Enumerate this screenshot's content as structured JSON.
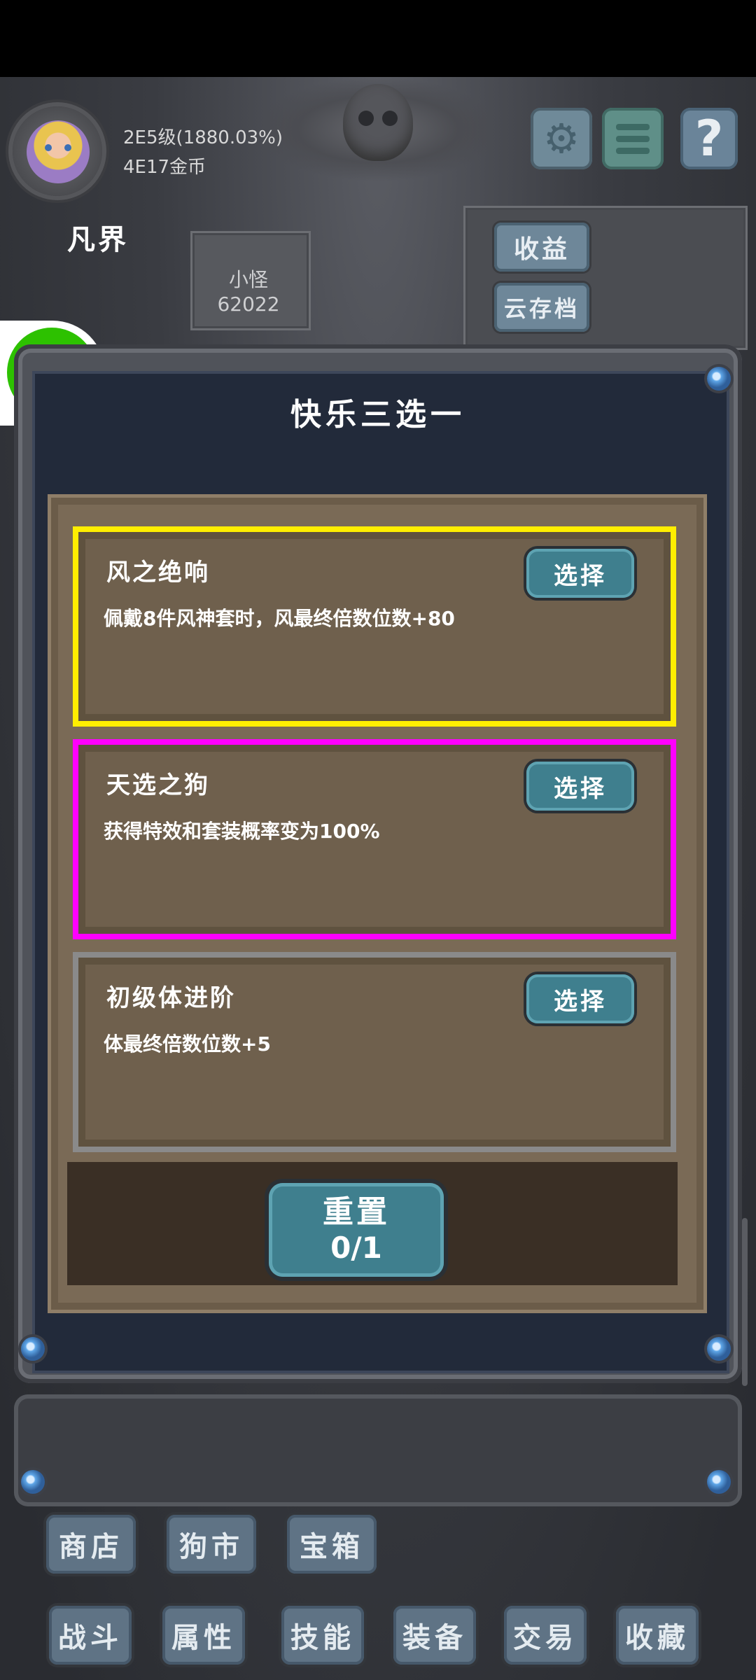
{
  "player": {
    "level": "2E5级(1880.03%)",
    "gold": "4E17金币",
    "realm": "凡界"
  },
  "enemy": {
    "name": "小怪",
    "count": "62022"
  },
  "top_buttons": {
    "income": "收益",
    "cloud_save": "云存档",
    "help": "?"
  },
  "dialog": {
    "title": "快乐三选一",
    "options": [
      {
        "title": "风之绝响",
        "desc": "佩戴8件风神套时，风最终倍数位数+80",
        "button": "选择",
        "highlight": "#ffee00"
      },
      {
        "title": "天选之狗",
        "desc": "获得特效和套装概率变为100%",
        "button": "选择",
        "highlight": "#ff00ff"
      },
      {
        "title": "初级体进阶",
        "desc": "体最终倍数位数+5",
        "button": "选择",
        "highlight": "#8a8a8a"
      }
    ],
    "reset": {
      "label": "重置",
      "count": "0/1"
    }
  },
  "nav_row1": [
    "商店",
    "狗市",
    "宝箱"
  ],
  "nav_row2": [
    "战斗",
    "属性",
    "技能",
    "装备",
    "交易",
    "收藏"
  ],
  "colors": {
    "accent_button": "#3f7f8e",
    "dialog_bg": "#222a3a",
    "wechat_green": "#2dc100"
  },
  "icons": [
    "gear-icon",
    "menu-icon",
    "help-icon",
    "wechat-icon"
  ]
}
